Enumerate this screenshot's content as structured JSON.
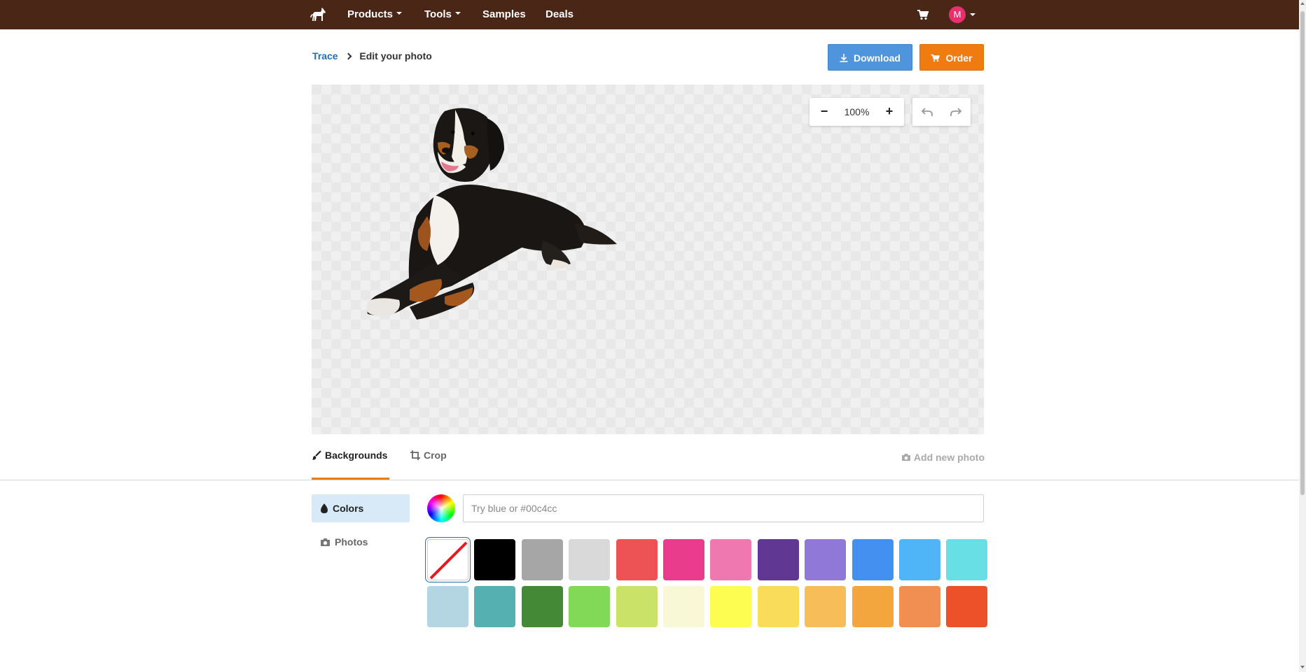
{
  "nav": {
    "products": "Products",
    "tools": "Tools",
    "samples": "Samples",
    "deals": "Deals",
    "avatar_initial": "M"
  },
  "breadcrumb": {
    "link": "Trace",
    "current": "Edit your photo"
  },
  "actions": {
    "download": "Download",
    "order": "Order"
  },
  "editor": {
    "zoom_minus": "−",
    "zoom_level": "100%",
    "zoom_plus": "+"
  },
  "tabs": {
    "backgrounds": "Backgrounds",
    "crop": "Crop",
    "add_photo": "Add new photo"
  },
  "sidebar": {
    "colors": "Colors",
    "photos": "Photos"
  },
  "color_picker": {
    "placeholder": "Try blue or #00c4cc",
    "value": ""
  },
  "colors": {
    "brand_bar": "#4a2617",
    "accent": "#f07b11",
    "link": "#1f6fb3",
    "swatches": [
      "none",
      "#000000",
      "#a6a6a6",
      "#d9d9d9",
      "#ed5355",
      "#ea3c8c",
      "#ef78b0",
      "#603893",
      "#8f78d7",
      "#4390f0",
      "#50b5f7",
      "#67dfe5",
      "#b4d6e3",
      "#55b1b1",
      "#448a36",
      "#82d957",
      "#cbe268",
      "#f8f8d6",
      "#fdfc51",
      "#f9dc5a",
      "#f7bd58",
      "#f2a63d",
      "#f08f51",
      "#ec5129"
    ],
    "selected": "none"
  }
}
